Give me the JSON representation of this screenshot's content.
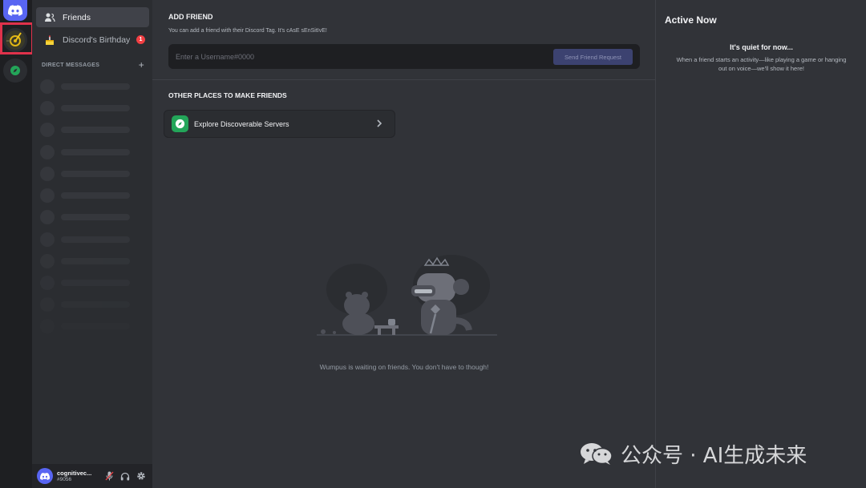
{
  "sidebar": {
    "friends_label": "Friends",
    "birthday_label": "Discord's Birthday",
    "birthday_badge": "1",
    "dm_header": "DIRECT MESSAGES",
    "dm_add": "+"
  },
  "user": {
    "name": "cognitivec...",
    "tag": "#9056"
  },
  "add_friend": {
    "title": "ADD FRIEND",
    "description": "You can add a friend with their Discord Tag. It's cAsE sEnSitIvE!",
    "placeholder": "Enter a Username#0000",
    "button_label": "Send Friend Request"
  },
  "other_places": {
    "title": "OTHER PLACES TO MAKE FRIENDS",
    "explore_label": "Explore Discoverable Servers"
  },
  "empty_state": {
    "text": "Wumpus is waiting on friends. You don't have to though!"
  },
  "active_now": {
    "title": "Active Now",
    "quiet_title": "It's quiet for now...",
    "quiet_description": "When a friend starts an activity—like playing a game or hanging out on voice—we'll show it here!"
  },
  "watermark": {
    "text": "公众号 · AI生成未来"
  },
  "colors": {
    "brand": "#5865f2",
    "green": "#23a559",
    "red_badge": "#f23f43",
    "highlight": "#e0324b"
  },
  "icons": [
    "discord-logo-icon",
    "server-icon",
    "compass-icon",
    "friends-icon",
    "cake-icon",
    "mic-muted-icon",
    "headphones-icon",
    "gear-icon",
    "chevron-right-icon"
  ]
}
